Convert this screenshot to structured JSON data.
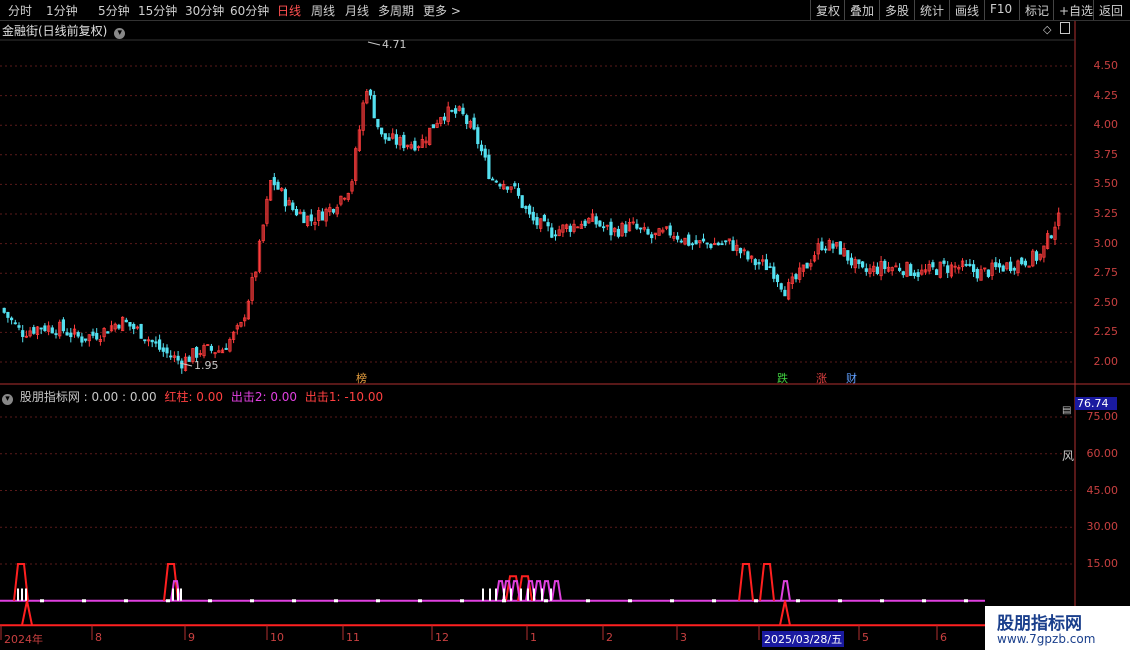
{
  "toolbar": {
    "periods": [
      "分时",
      "1分钟",
      "5分钟",
      "15分钟",
      "30分钟",
      "60分钟",
      "日线",
      "周线",
      "月线",
      "多周期",
      "更多 >"
    ],
    "active_period": "日线",
    "right_buttons": [
      "复权",
      "叠加",
      "多股",
      "统计",
      "画线",
      "F10",
      "标记",
      "+自选",
      "返回"
    ]
  },
  "main_chart": {
    "title": "金融街(日线前复权)",
    "high_marker": "4.71",
    "low_marker": "1.95",
    "price_axis": [
      "4.50",
      "4.25",
      "4.00",
      "3.75",
      "3.50",
      "3.25",
      "3.00",
      "2.75",
      "2.50",
      "2.25",
      "2.00"
    ],
    "tags": [
      "榜",
      "跌",
      "涨",
      "财"
    ]
  },
  "indicator": {
    "title": "股朋指标网 : 0.00 : 0.00",
    "red_column": "红柱: 0.00",
    "strike2": "出击2: 0.00",
    "strike1": "出击1: -10.00",
    "value_axis": [
      "75.00",
      "60.00",
      "45.00",
      "30.00",
      "15.00"
    ],
    "current_value": "76.74",
    "side_label": "风"
  },
  "date_axis": {
    "labels": [
      "2024年",
      "8",
      "9",
      "10",
      "11",
      "12",
      "1",
      "2",
      "3",
      "2025/03/28/五",
      "5",
      "6"
    ]
  },
  "watermark": {
    "line1": "股朋指标网",
    "line2": "www.7gpzb.com"
  },
  "chart_data": [
    {
      "type": "candlestick",
      "title": "金融街(日线前复权)",
      "ylim": [
        1.9,
        4.75
      ],
      "yticks": [
        2.0,
        2.25,
        2.5,
        2.75,
        3.0,
        3.25,
        3.5,
        3.75,
        4.0,
        4.25,
        4.5
      ],
      "x_labels": [
        "2024年",
        "8",
        "9",
        "10",
        "11",
        "12",
        "1",
        "2",
        "3",
        "2025/03/28/五",
        "5",
        "6"
      ],
      "annotations": [
        {
          "label": "4.71",
          "type": "high"
        },
        {
          "label": "1.95",
          "type": "low"
        }
      ],
      "approx_close_path": [
        [
          0,
          2.45
        ],
        [
          20,
          2.25
        ],
        [
          40,
          2.3
        ],
        [
          60,
          2.28
        ],
        [
          80,
          2.2
        ],
        [
          100,
          2.25
        ],
        [
          120,
          2.35
        ],
        [
          140,
          2.25
        ],
        [
          160,
          2.1
        ],
        [
          180,
          2.0
        ],
        [
          200,
          2.1
        ],
        [
          220,
          2.1
        ],
        [
          240,
          2.3
        ],
        [
          255,
          2.8
        ],
        [
          270,
          3.55
        ],
        [
          290,
          3.3
        ],
        [
          310,
          3.2
        ],
        [
          330,
          3.3
        ],
        [
          350,
          3.5
        ],
        [
          365,
          4.35
        ],
        [
          380,
          3.9
        ],
        [
          400,
          3.85
        ],
        [
          420,
          3.85
        ],
        [
          440,
          4.1
        ],
        [
          460,
          4.1
        ],
        [
          475,
          3.9
        ],
        [
          490,
          3.55
        ],
        [
          510,
          3.5
        ],
        [
          530,
          3.2
        ],
        [
          550,
          3.1
        ],
        [
          570,
          3.15
        ],
        [
          590,
          3.2
        ],
        [
          610,
          3.1
        ],
        [
          630,
          3.15
        ],
        [
          650,
          3.05
        ],
        [
          670,
          3.1
        ],
        [
          690,
          3.0
        ],
        [
          710,
          3.0
        ],
        [
          730,
          3.0
        ],
        [
          750,
          2.85
        ],
        [
          770,
          2.8
        ],
        [
          785,
          2.6
        ],
        [
          800,
          2.75
        ],
        [
          820,
          3.0
        ],
        [
          840,
          2.95
        ],
        [
          860,
          2.75
        ],
        [
          880,
          2.8
        ],
        [
          900,
          2.8
        ],
        [
          920,
          2.75
        ],
        [
          940,
          2.8
        ],
        [
          960,
          2.8
        ],
        [
          980,
          2.75
        ],
        [
          1000,
          2.8
        ],
        [
          1020,
          2.85
        ],
        [
          1040,
          2.9
        ],
        [
          1055,
          3.2
        ]
      ]
    },
    {
      "type": "line",
      "title": "股朋指标网",
      "ylim": [
        -10,
        80
      ],
      "yticks": [
        15,
        30,
        45,
        60,
        75
      ],
      "series": [
        {
          "name": "红柱",
          "values": [
            0
          ]
        },
        {
          "name": "出击2",
          "values": [
            0
          ]
        },
        {
          "name": "出击1",
          "values": [
            -10
          ]
        }
      ]
    }
  ]
}
